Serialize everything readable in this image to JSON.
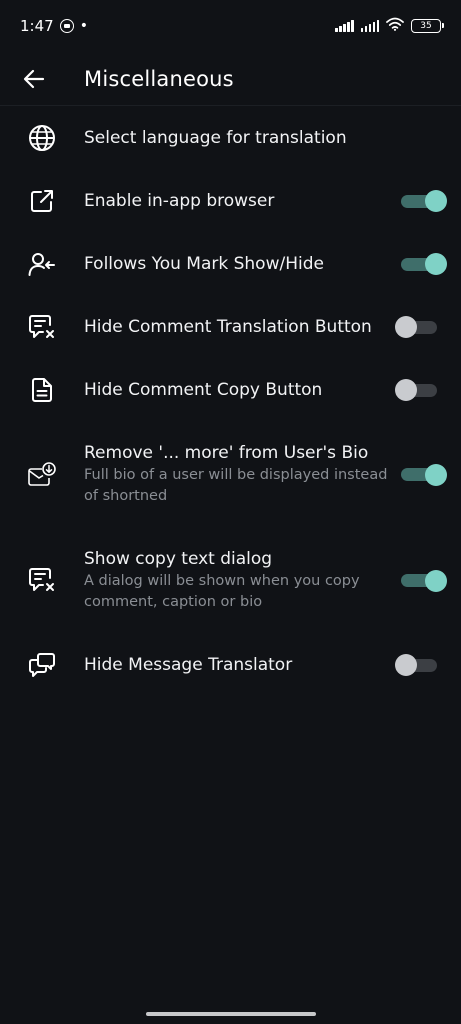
{
  "status_bar": {
    "time": "1:47",
    "battery": "35"
  },
  "header": {
    "title": "Miscellaneous"
  },
  "settings": [
    {
      "icon": "globe-icon",
      "label": "Select language for translation"
    },
    {
      "icon": "external-link-icon",
      "label": "Enable in-app browser",
      "toggle": true
    },
    {
      "icon": "user-follow-icon",
      "label": "Follows You Mark Show/Hide",
      "toggle": true
    },
    {
      "icon": "comment-translate-off-icon",
      "label": "Hide Comment Translation Button",
      "toggle": false
    },
    {
      "icon": "document-icon",
      "label": "Hide Comment Copy Button",
      "toggle": false
    },
    {
      "icon": "mail-download-icon",
      "label": "Remove  '... more'  from User's Bio",
      "description": "Full bio of a user will be displayed instead of shortned",
      "toggle": true
    },
    {
      "icon": "comment-copy-icon",
      "label": "Show copy text dialog",
      "description": "A dialog will be shown when you copy comment, caption or bio",
      "toggle": true
    },
    {
      "icon": "message-translate-icon",
      "label": "Hide Message Translator",
      "toggle": false
    }
  ],
  "colors": {
    "background": "#101216",
    "toggle_on_thumb": "#7fd2c6",
    "toggle_on_track": "#3f6e6a",
    "toggle_off_thumb": "#c9cbcf",
    "toggle_off_track": "#3c3f44",
    "secondary_text": "#8a8e94"
  }
}
